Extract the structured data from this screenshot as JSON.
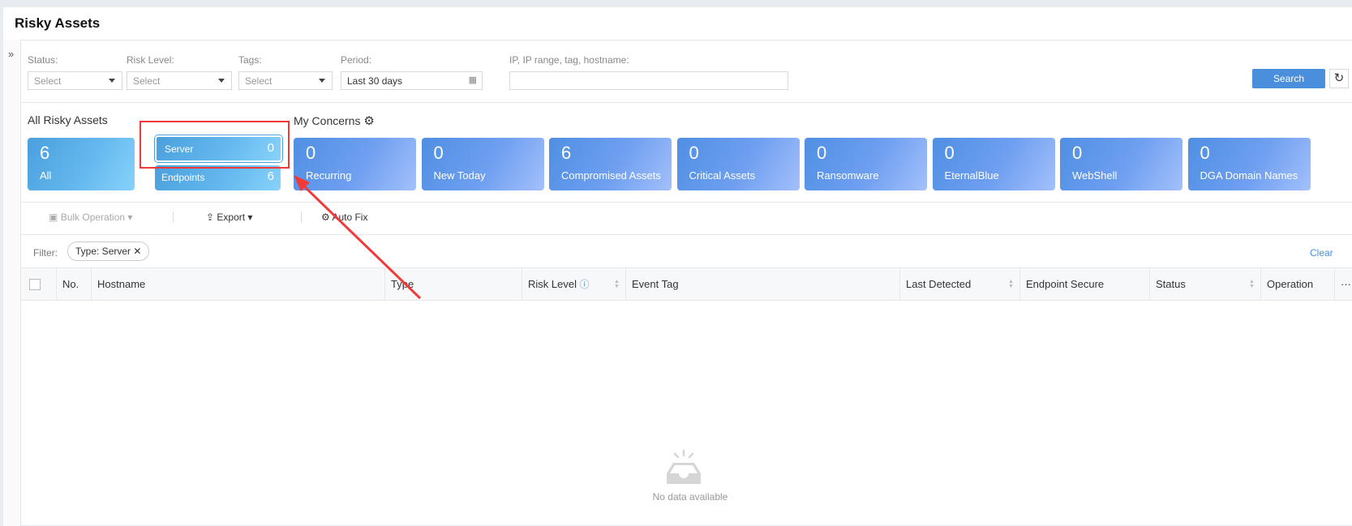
{
  "page_title": "Risky Assets",
  "filters": {
    "status": {
      "label": "Status:",
      "value": "Select"
    },
    "risk_level": {
      "label": "Risk Level:",
      "value": "Select"
    },
    "tags": {
      "label": "Tags:",
      "value": "Select"
    },
    "period": {
      "label": "Period:",
      "value": "Last 30 days"
    },
    "query": {
      "label": "IP, IP range, tag, hostname:",
      "value": ""
    },
    "search_label": "Search"
  },
  "all_assets": {
    "heading": "All Risky Assets",
    "all": {
      "count": "6",
      "label": "All"
    },
    "server": {
      "label": "Server",
      "count": "0"
    },
    "endpoints": {
      "label": "Endpoints",
      "count": "6"
    }
  },
  "concerns": {
    "heading": "My Concerns",
    "items": [
      {
        "count": "0",
        "label": "Recurring"
      },
      {
        "count": "0",
        "label": "New Today"
      },
      {
        "count": "6",
        "label": "Compromised Assets"
      },
      {
        "count": "0",
        "label": "Critical Assets"
      },
      {
        "count": "0",
        "label": "Ransomware"
      },
      {
        "count": "0",
        "label": "EternalBlue"
      },
      {
        "count": "0",
        "label": "WebShell"
      },
      {
        "count": "0",
        "label": "DGA Domain Names"
      }
    ]
  },
  "toolbar": {
    "bulk": "Bulk Operation",
    "export": "Export",
    "autofix": "Auto Fix"
  },
  "filter_bar": {
    "label": "Filter:",
    "chip": "Type: Server",
    "clear": "Clear"
  },
  "table": {
    "columns": [
      "No.",
      "Hostname",
      "Type",
      "Risk Level",
      "Event Tag",
      "Last Detected",
      "Endpoint Secure",
      "Status",
      "Operation"
    ],
    "more": "···",
    "empty": "No data available"
  },
  "colors": {
    "accent": "#4a8fdc",
    "annotation": "#f03a3a"
  }
}
